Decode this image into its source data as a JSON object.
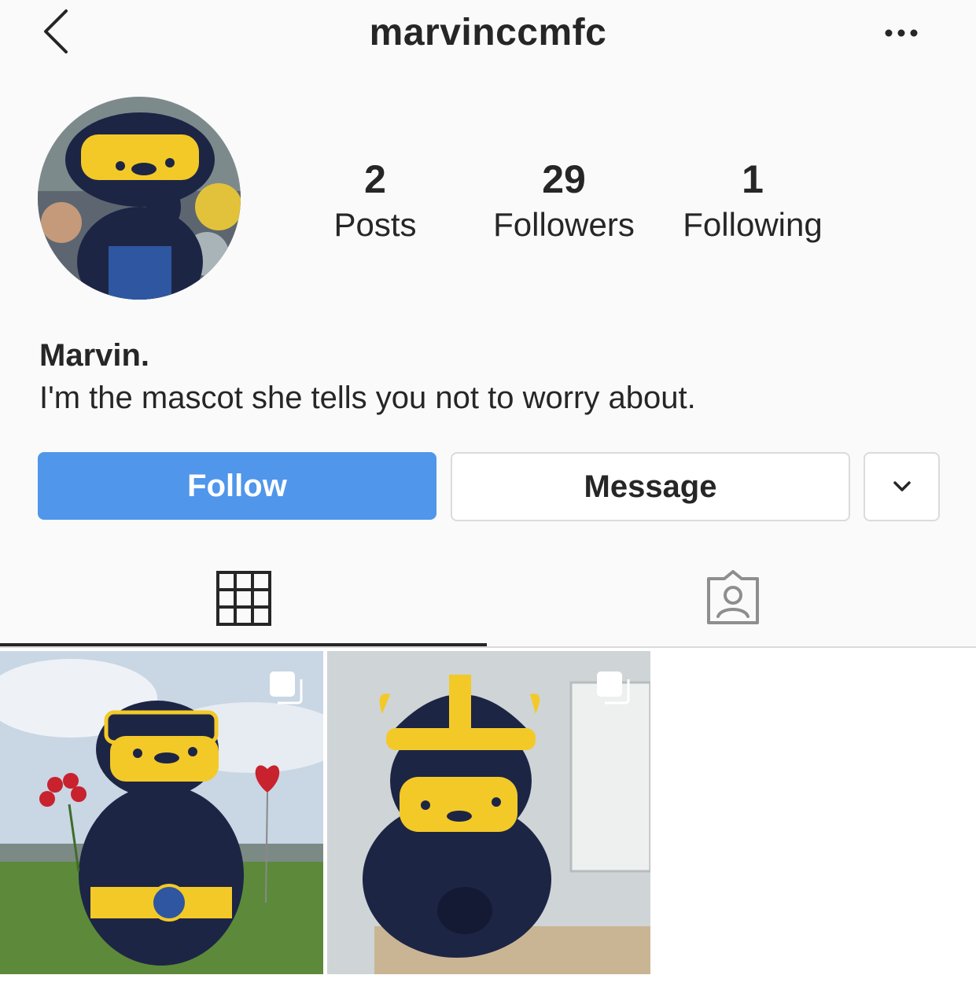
{
  "header": {
    "username": "marvinccmfc",
    "back_icon": "chevron-left-icon",
    "more_icon": "more-horizontal-icon"
  },
  "profile": {
    "stats": [
      {
        "value": "2",
        "label": "Posts"
      },
      {
        "value": "29",
        "label": "Followers"
      },
      {
        "value": "1",
        "label": "Following"
      }
    ],
    "name": "Marvin.",
    "bio": "I'm the mascot she tells you not to worry about."
  },
  "actions": {
    "follow_label": "Follow",
    "message_label": "Message",
    "dropdown_icon": "chevron-down-icon"
  },
  "tabs": [
    {
      "icon": "grid-icon",
      "active": true
    },
    {
      "icon": "tagged-person-icon",
      "active": false
    }
  ],
  "posts": [
    {
      "icon": "multiple-photos-icon"
    },
    {
      "icon": "multiple-photos-icon"
    }
  ],
  "colors": {
    "accent": "#5096ea",
    "mascot_navy": "#1d2545",
    "mascot_yellow": "#f3c928"
  }
}
